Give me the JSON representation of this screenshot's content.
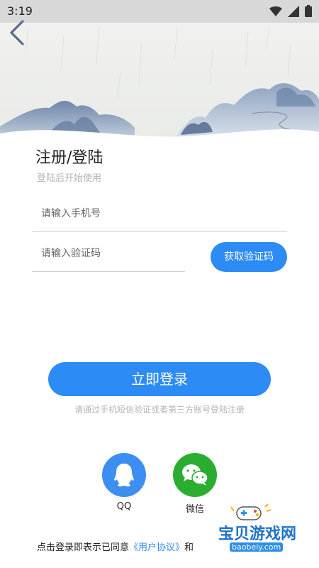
{
  "status": {
    "time": "3:19"
  },
  "page": {
    "title": "注册/登陆",
    "subtitle": "登陆后开始使用",
    "phone_placeholder": "请输入手机号",
    "code_placeholder": "请输入验证码",
    "get_code_label": "获取验证码",
    "login_label": "立即登录",
    "hint": "请通过手机短信验证或者第三方账号登陆注册"
  },
  "social": {
    "qq_label": "QQ",
    "wechat_label": "微信"
  },
  "agreement": {
    "prefix": "点击登录即表示已同意",
    "link": "《用户协议》",
    "suffix": "和"
  },
  "watermark": {
    "text": "宝贝游戏网",
    "url": "baobeiy.com"
  },
  "colors": {
    "primary": "#2c8bf5",
    "qq": "#3c8ef0",
    "wechat": "#2bae2f"
  }
}
